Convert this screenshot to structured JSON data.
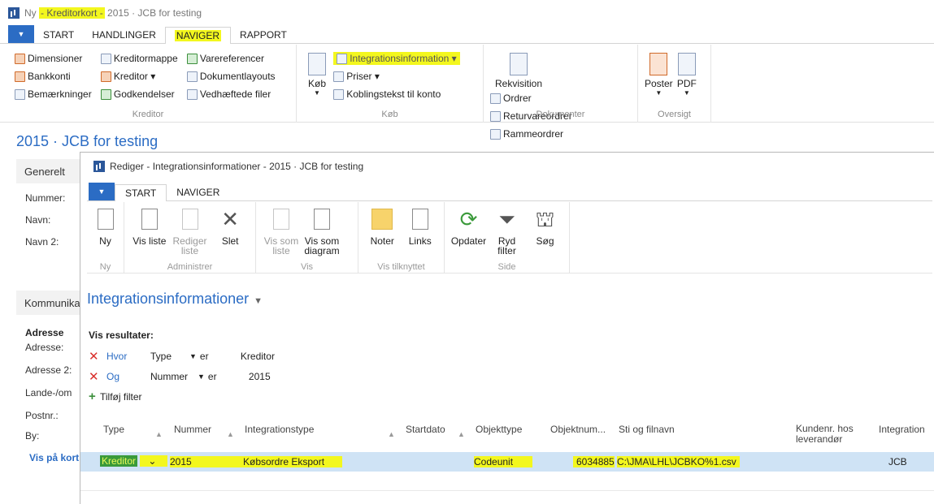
{
  "window": {
    "title_prefix": "Ny",
    "title_highlight": "- Kreditorkort -",
    "title_suffix": "2015 · JCB for testing"
  },
  "ribbon_tabs": [
    "START",
    "HANDLINGER",
    "NAVIGER",
    "RAPPORT"
  ],
  "ribbon": {
    "kreditor_group": {
      "label": "Kreditor",
      "col1": [
        "Dimensioner",
        "Bankkonti",
        "Bemærkninger"
      ],
      "col2": [
        "Kreditormappe",
        "Kreditor ▾",
        "Godkendelser"
      ],
      "col3": [
        "Varereferencer",
        "Dokumentlayouts",
        "Vedhæftede filer"
      ]
    },
    "kob_group": {
      "label": "Køb",
      "big": "Køb",
      "items": [
        "Integrationsinformation ▾",
        "Priser ▾",
        "Koblingstekst til konto"
      ]
    },
    "dokumenter_group": {
      "label": "Dokumenter",
      "big": "Rekvisition",
      "items": [
        "Ordrer",
        "Returvareordrer",
        "Rammeordrer"
      ]
    },
    "oversigt_group": {
      "label": "Oversigt",
      "items": [
        "Poster",
        "PDF"
      ]
    }
  },
  "page_title": "2015 · JCB for testing",
  "card": {
    "generelt": "Generelt",
    "labels": [
      "Nummer:",
      "Navn:",
      "Navn 2:"
    ],
    "kommunikation": "Kommunika",
    "adresse_head": "Adresse",
    "address_labels": [
      "Adresse:",
      "Adresse 2:",
      "Lande-/om",
      "Postnr.:",
      "By:"
    ],
    "vis_link": "Vis på kort"
  },
  "dialog": {
    "title": "Rediger - Integrationsinformationer - 2015 · JCB for testing",
    "tabs": [
      "START",
      "NAVIGER"
    ],
    "groups": {
      "ny": {
        "label": "Ny",
        "btn": "Ny"
      },
      "administrer": {
        "label": "Administrer",
        "btns": [
          "Vis liste",
          "Rediger liste",
          "Slet"
        ]
      },
      "vis": {
        "label": "Vis",
        "btns": [
          "Vis som liste",
          "Vis som diagram"
        ]
      },
      "vis_tilknyttet": {
        "label": "Vis tilknyttet",
        "btns": [
          "Noter",
          "Links"
        ]
      },
      "side": {
        "label": "Side",
        "btns": [
          "Opdater",
          "Ryd filter",
          "Søg"
        ]
      }
    },
    "list_title": "Integrationsinformationer",
    "filters": {
      "head": "Vis resultater:",
      "rows": [
        {
          "word": "Hvor",
          "field": "Type",
          "op": "er",
          "value": "Kreditor"
        },
        {
          "word": "Og",
          "field": "Nummer",
          "op": "er",
          "value": "2015"
        }
      ],
      "add": "Tilføj filter"
    },
    "columns": [
      "Type",
      "Nummer",
      "Integrationstype",
      "Startdato",
      "Objekttype",
      "Objektnum...",
      "Sti og filnavn",
      "Kundenr. hos leverandør",
      "Integration"
    ],
    "row": {
      "type": "Kreditor",
      "nummer": "2015",
      "integrationstype": "Købsordre Eksport",
      "startdato": "",
      "objekttype": "Codeunit",
      "objektnummer": "6034885",
      "sti": "C:\\JMA\\LHL\\JCBKO%1.csv",
      "kundenr": "",
      "integration": "JCB"
    }
  },
  "colors": {
    "accent": "#2b6cc4",
    "highlight": "#f3f71e",
    "selected_row": "#cfe3f5"
  }
}
